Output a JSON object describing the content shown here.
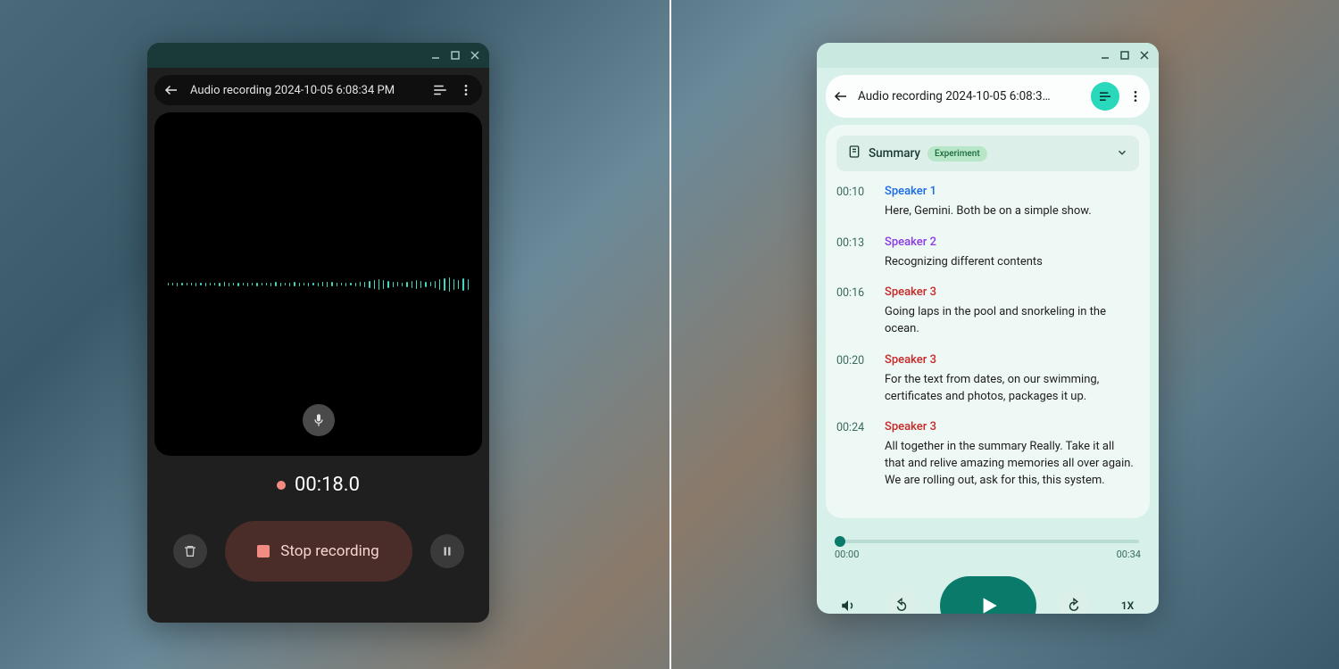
{
  "left": {
    "title": "Audio recording 2024-10-05 6:08:34 PM",
    "timer": "00:18.0",
    "stop_label": "Stop recording"
  },
  "right": {
    "title": "Audio recording 2024-10-05 6:08:3…",
    "summary_label": "Summary",
    "experiment_badge": "Experiment",
    "entries": [
      {
        "ts": "00:10",
        "speaker": "Speaker 1",
        "color": "c1",
        "text": "Here, Gemini. Both be on a simple show."
      },
      {
        "ts": "00:13",
        "speaker": "Speaker 2",
        "color": "c2",
        "text": "Recognizing different contents"
      },
      {
        "ts": "00:16",
        "speaker": "Speaker 3",
        "color": "c3",
        "text": "Going laps in the pool and snorkeling in the ocean."
      },
      {
        "ts": "00:20",
        "speaker": "Speaker 3",
        "color": "c3",
        "text": "For the text from dates, on our swimming, certificates and photos, packages it up."
      },
      {
        "ts": "00:24",
        "speaker": "Speaker 3",
        "color": "c3",
        "text": "All together in the summary Really. Take it all that and relive amazing memories all over again. We are rolling out, ask for this, this system."
      }
    ],
    "time_current": "00:00",
    "time_total": "00:34",
    "speed": "1X"
  }
}
